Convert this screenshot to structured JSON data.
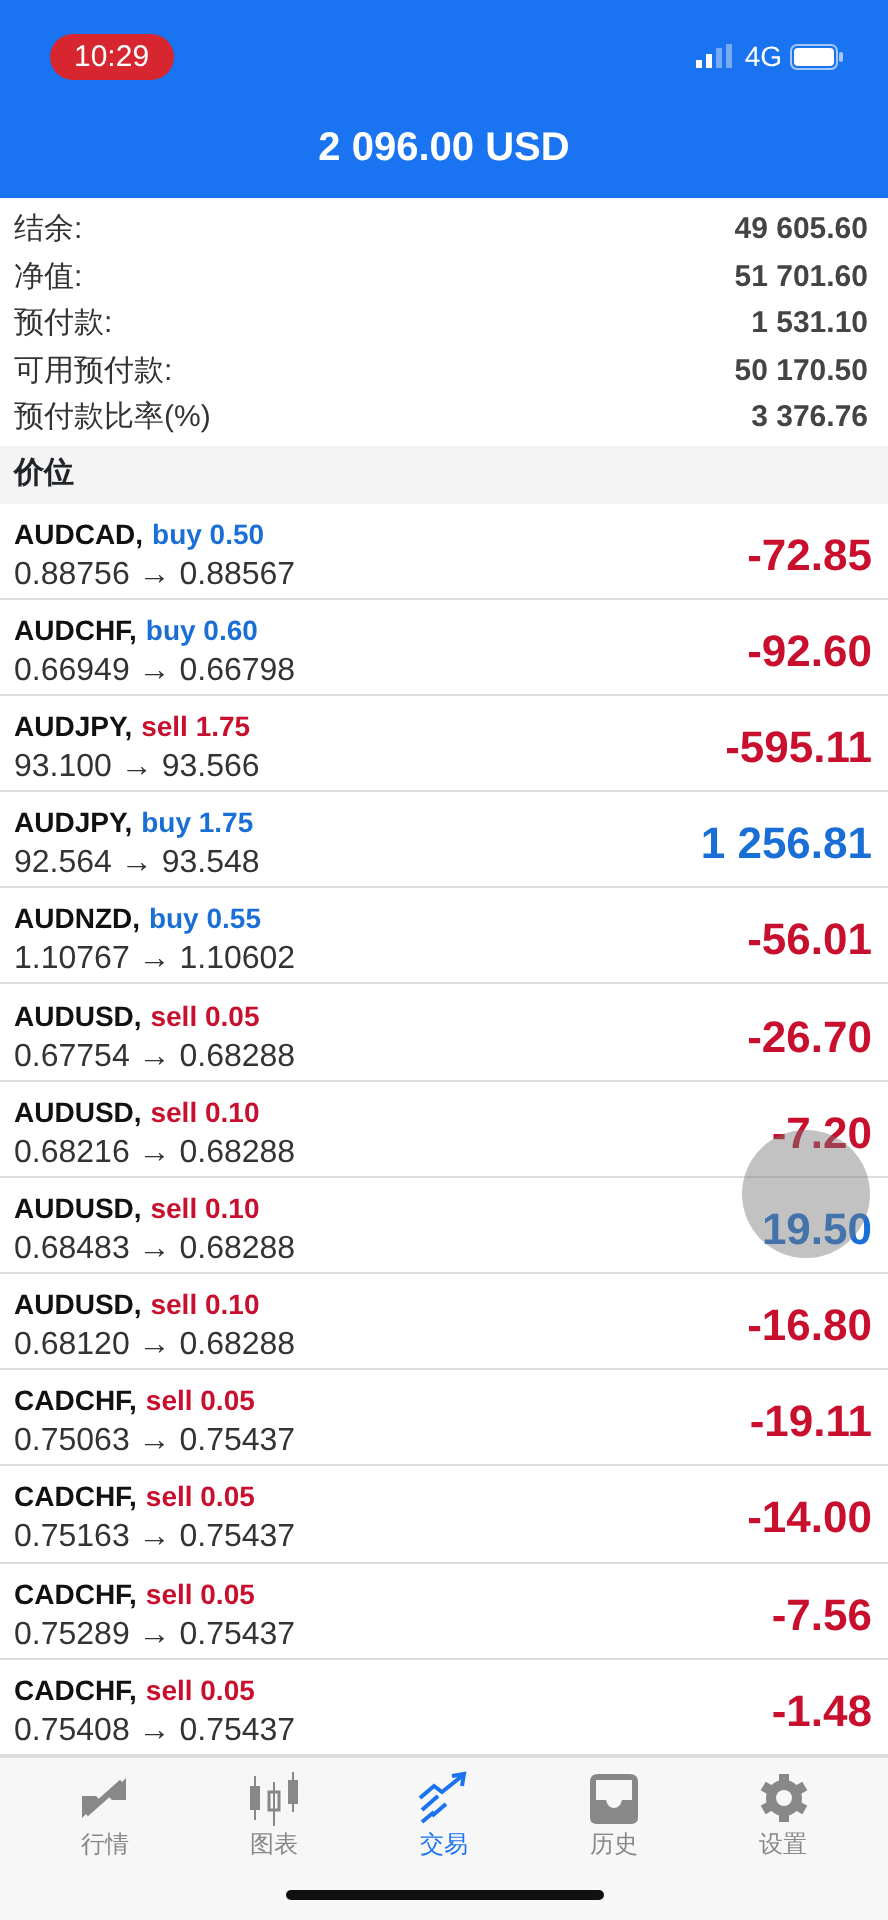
{
  "status_bar": {
    "time": "10:29",
    "network": "4G"
  },
  "header": {
    "title": "2 096.00 USD"
  },
  "summary": [
    {
      "label": "结余:",
      "value": "49 605.60"
    },
    {
      "label": "净值:",
      "value": "51 701.60"
    },
    {
      "label": "预付款:",
      "value": "1 531.10"
    },
    {
      "label": "可用预付款:",
      "value": "50 170.50"
    },
    {
      "label": "预付款比率(%)",
      "value": "3 376.76"
    }
  ],
  "section": {
    "title": "价位"
  },
  "positions": [
    {
      "symbol": "AUDCAD,",
      "kind": "buy",
      "volume": "buy 0.50",
      "prices": "0.88756 → 0.88567",
      "profit": "-72.85",
      "color": "#c8102e"
    },
    {
      "symbol": "AUDCHF,",
      "kind": "buy",
      "volume": "buy 0.60",
      "prices": "0.66949 → 0.66798",
      "profit": "-92.60",
      "color": "#c8102e"
    },
    {
      "symbol": "AUDJPY,",
      "kind": "sell",
      "volume": "sell 1.75",
      "prices": "93.100 → 93.566",
      "profit": "-595.11",
      "color": "#c8102e"
    },
    {
      "symbol": "AUDJPY,",
      "kind": "buy",
      "volume": "buy 1.75",
      "prices": "92.564 → 93.548",
      "profit": "1 256.81",
      "color": "#1a6fd6"
    },
    {
      "symbol": "AUDNZD,",
      "kind": "buy",
      "volume": "buy 0.55",
      "prices": "1.10767 → 1.10602",
      "profit": "-56.01",
      "color": "#c8102e"
    },
    {
      "symbol": "AUDUSD,",
      "kind": "sell",
      "volume": "sell 0.05",
      "prices": "0.67754 → 0.68288",
      "profit": "-26.70",
      "color": "#c8102e"
    },
    {
      "symbol": "AUDUSD,",
      "kind": "sell",
      "volume": "sell 0.10",
      "prices": "0.68216 → 0.68288",
      "profit": "-7.20",
      "color": "#c8102e"
    },
    {
      "symbol": "AUDUSD,",
      "kind": "sell",
      "volume": "sell 0.10",
      "prices": "0.68483 → 0.68288",
      "profit": "19.50",
      "color": "#1a6fd6"
    },
    {
      "symbol": "AUDUSD,",
      "kind": "sell",
      "volume": "sell 0.10",
      "prices": "0.68120 → 0.68288",
      "profit": "-16.80",
      "color": "#c8102e"
    },
    {
      "symbol": "CADCHF,",
      "kind": "sell",
      "volume": "sell 0.05",
      "prices": "0.75063 → 0.75437",
      "profit": "-19.11",
      "color": "#c8102e"
    },
    {
      "symbol": "CADCHF,",
      "kind": "sell",
      "volume": "sell 0.05",
      "prices": "0.75163 → 0.75437",
      "profit": "-14.00",
      "color": "#c8102e"
    },
    {
      "symbol": "CADCHF,",
      "kind": "sell",
      "volume": "sell 0.05",
      "prices": "0.75289 → 0.75437",
      "profit": "-7.56",
      "color": "#c8102e"
    },
    {
      "symbol": "CADCHF,",
      "kind": "sell",
      "volume": "sell 0.05",
      "prices": "0.75408 → 0.75437",
      "profit": "-1.48",
      "color": "#c8102e"
    }
  ],
  "tab_bar": [
    {
      "kind": "quotes",
      "label": "行情",
      "selected": false
    },
    {
      "kind": "chart",
      "label": "图表",
      "selected": false
    },
    {
      "kind": "trade",
      "label": "交易",
      "selected": true
    },
    {
      "kind": "history",
      "label": "历史",
      "selected": false
    },
    {
      "kind": "settings",
      "label": "设置",
      "selected": false
    }
  ]
}
